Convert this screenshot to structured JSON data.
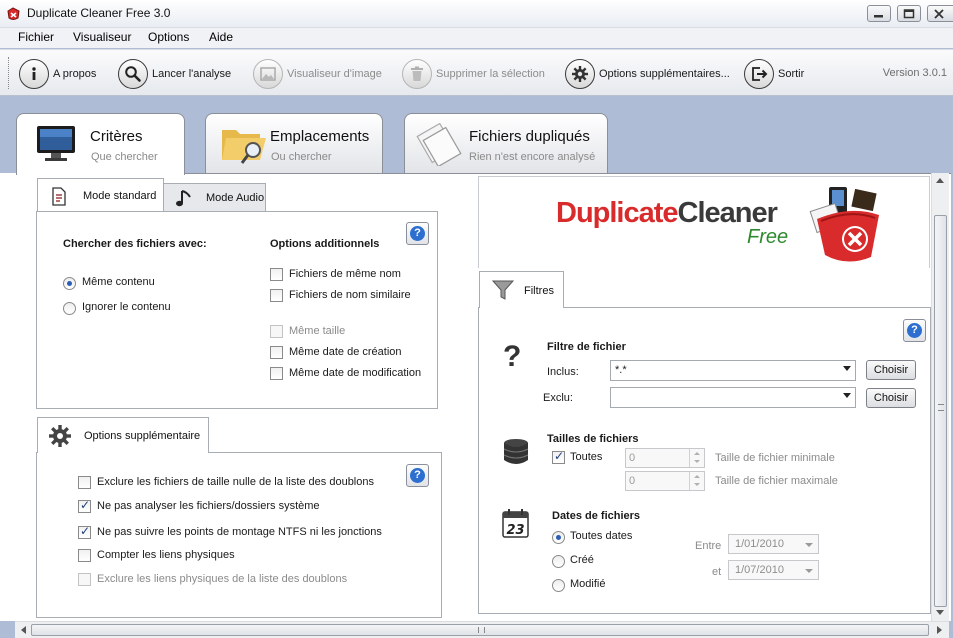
{
  "window": {
    "title": "Duplicate Cleaner Free 3.0"
  },
  "menu": {
    "items": [
      "Fichier",
      "Visualiseur",
      "Options",
      "Aide"
    ]
  },
  "toolbar": {
    "about": "A propos",
    "scan": "Lancer l'analyse",
    "viewer": "Visualiseur d'image",
    "delete": "Supprimer la sélection",
    "options": "Options supplémentaires...",
    "exit": "Sortir",
    "version": "Version 3.0.1"
  },
  "main_tabs": [
    {
      "title": "Critères",
      "subtitle": "Que chercher"
    },
    {
      "title": "Emplacements",
      "subtitle": "Ou chercher"
    },
    {
      "title": "Fichiers dupliqués",
      "subtitle": "Rien n'est encore analysé"
    }
  ],
  "criteria": {
    "mode_tabs": [
      "Mode standard",
      "Mode Audio"
    ],
    "search_heading": "Chercher des fichiers avec:",
    "search_options": [
      "Même contenu",
      "Ignorer le contenu"
    ],
    "additional_heading": "Options additionnels",
    "additional_options": [
      {
        "label": "Fichiers de même nom",
        "checked": false,
        "enabled": true
      },
      {
        "label": "Fichiers de nom similaire",
        "checked": false,
        "enabled": true
      },
      {
        "label": "Même taille",
        "checked": false,
        "enabled": false
      },
      {
        "label": "Même date de création",
        "checked": false,
        "enabled": true
      },
      {
        "label": "Même date de modification",
        "checked": false,
        "enabled": true
      }
    ]
  },
  "extra_options": {
    "tab_label": "Options supplémentaire",
    "items": [
      {
        "label": "Exclure les fichiers de taille nulle de la liste des doublons",
        "checked": false,
        "enabled": true
      },
      {
        "label": "Ne pas analyser les fichiers/dossiers système",
        "checked": true,
        "enabled": true
      },
      {
        "label": "Ne pas suivre les points de montage NTFS ni les jonctions",
        "checked": true,
        "enabled": true
      },
      {
        "label": "Compter les liens physiques",
        "checked": false,
        "enabled": true
      },
      {
        "label": "Exclure les liens physiques de la liste des doublons",
        "checked": false,
        "enabled": false
      }
    ]
  },
  "logo": {
    "text_duplicate": "Duplicate",
    "text_cleaner": "Cleaner",
    "text_free": "Free"
  },
  "filters": {
    "tab_label": "Filtres",
    "file_filter": {
      "heading": "Filtre de fichier",
      "include_label": "Inclus:",
      "include_value": "*.*",
      "exclude_label": "Exclu:",
      "exclude_value": "",
      "choose_label": "Choisir"
    },
    "sizes": {
      "heading": "Tailles de fichiers",
      "all_label": "Toutes",
      "all_checked": true,
      "min_value": "0",
      "max_value": "0",
      "min_label": "Taille de fichier minimale",
      "max_label": "Taille de fichier maximale"
    },
    "dates": {
      "heading": "Dates de fichiers",
      "options": [
        "Toutes dates",
        "Créé",
        "Modifié"
      ],
      "selected": "Toutes dates",
      "between_label": "Entre",
      "and_label": "et",
      "from_value": "1/01/2010",
      "to_value": "1/07/2010",
      "calendar_number": "23"
    }
  },
  "colors": {
    "desktop": "#aebcd6",
    "logo_red": "#d92b2b",
    "logo_green": "#2e8a2e",
    "help_blue": "#2c6fd0"
  }
}
